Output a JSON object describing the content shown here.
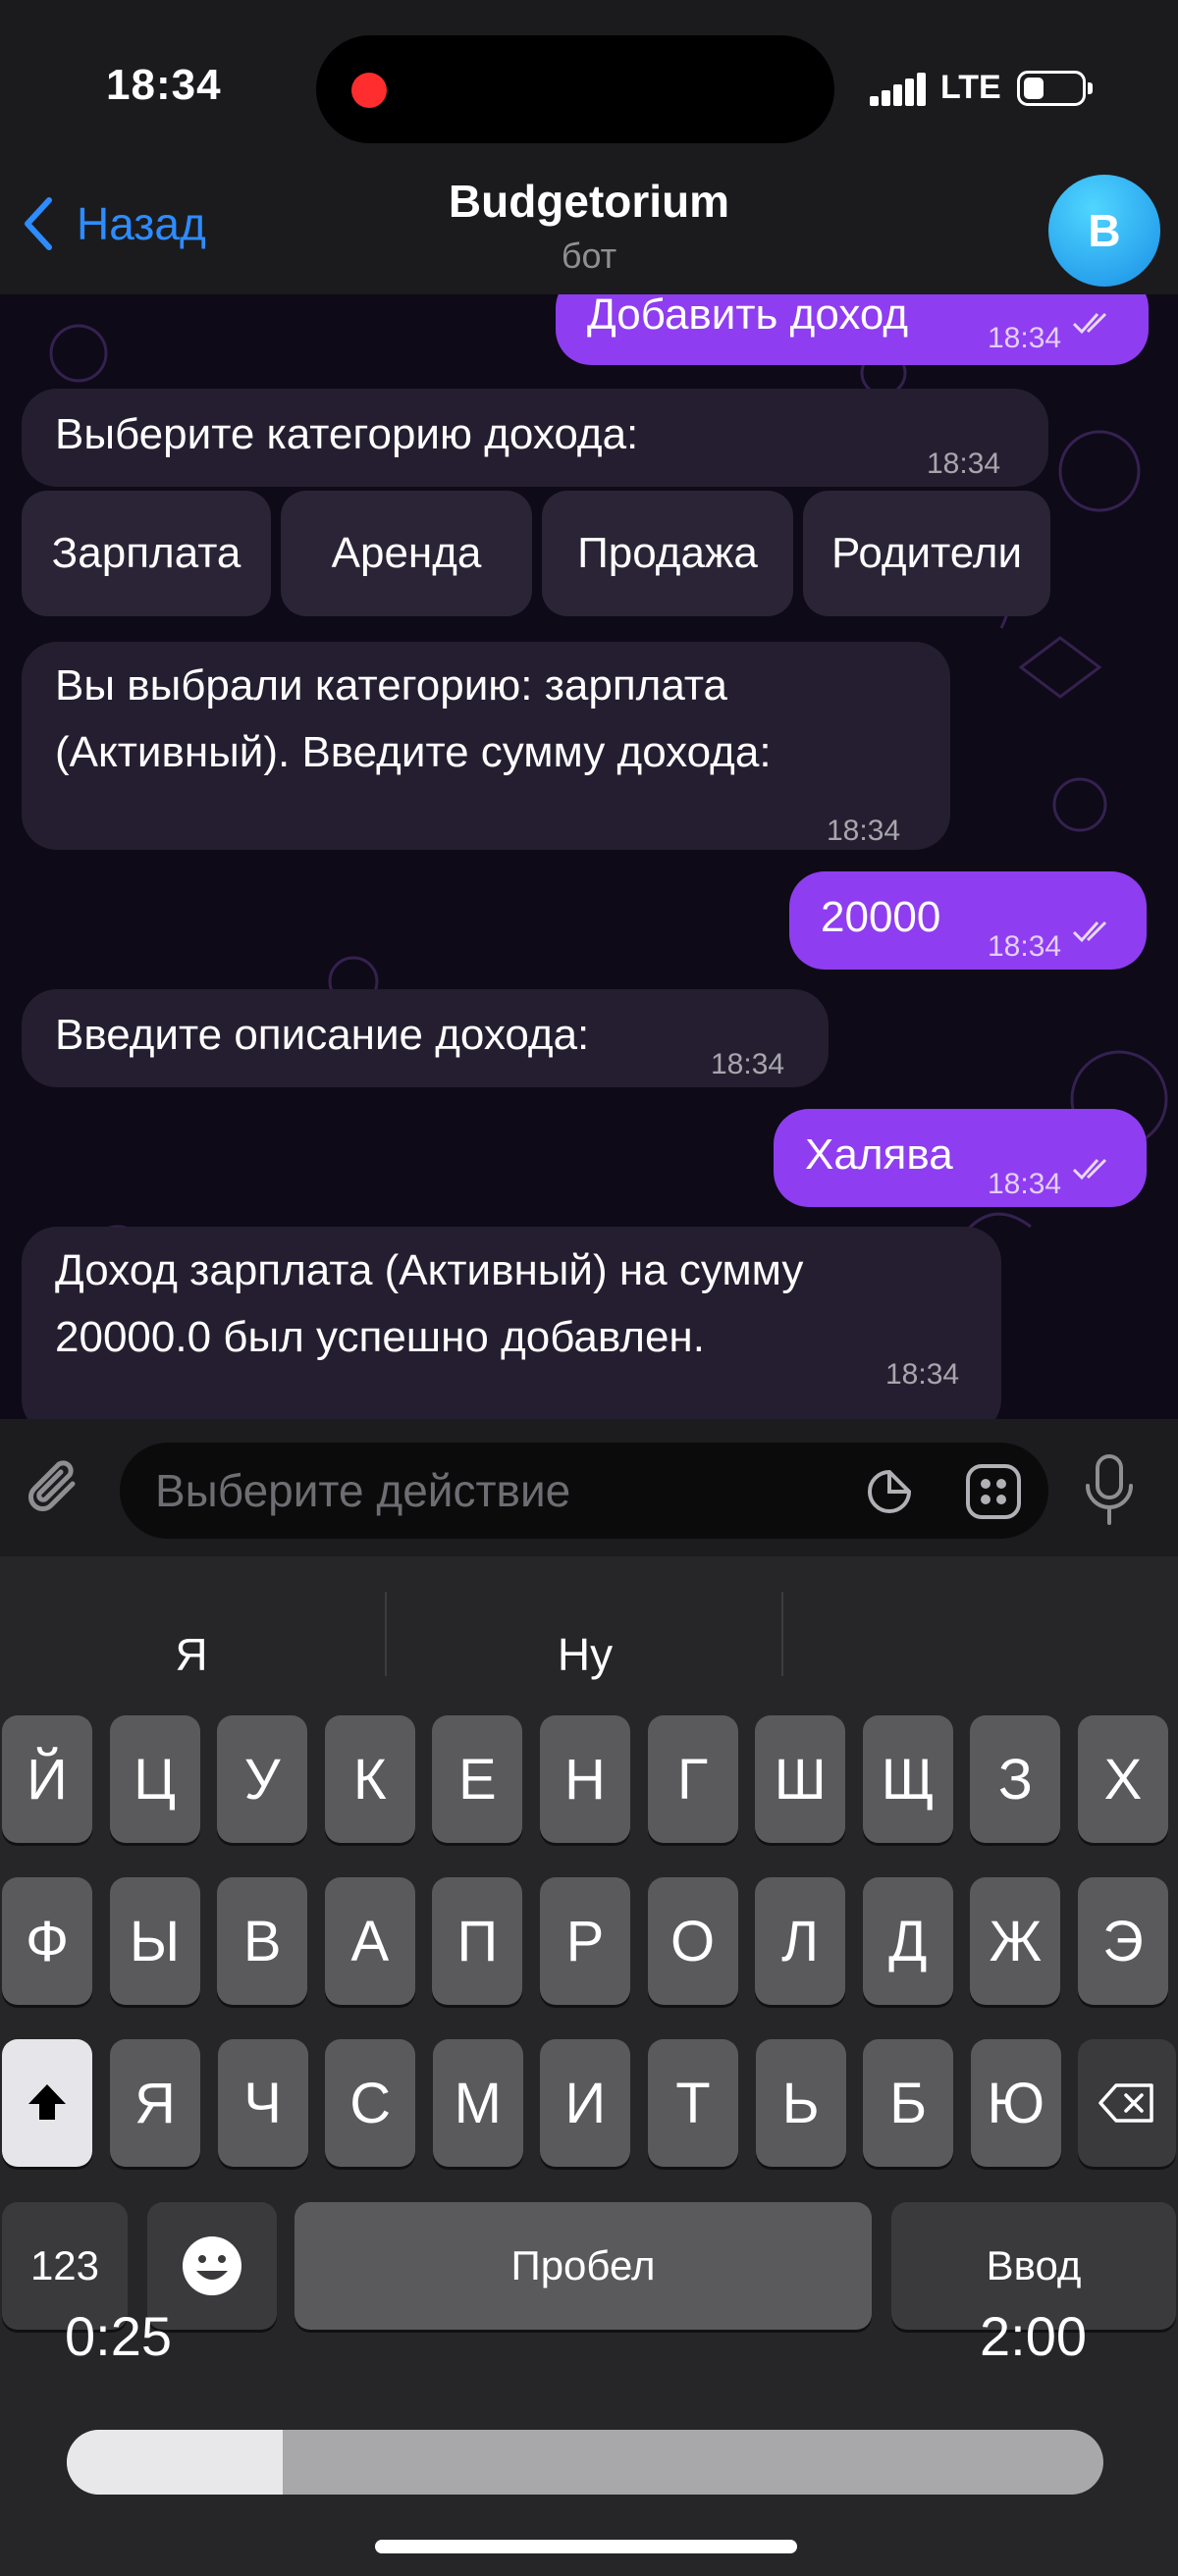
{
  "status": {
    "time": "18:34",
    "network": "LTE"
  },
  "header": {
    "back_label": "Назад",
    "title": "Budgetorium",
    "subtitle": "бот",
    "avatar_letter": "B"
  },
  "messages": [
    {
      "dir": "out",
      "text": "Добавить доход",
      "time": "18:34"
    },
    {
      "dir": "in",
      "text": "Выберите категорию дохода:",
      "time": "18:34"
    },
    {
      "dir": "in",
      "text_lines": [
        "Вы выбрали категорию: зарплата",
        "(Активный). Введите сумму дохода:"
      ],
      "time": "18:34"
    },
    {
      "dir": "out",
      "text": "20000",
      "time": "18:34"
    },
    {
      "dir": "in",
      "text": "Введите описание дохода:",
      "time": "18:34"
    },
    {
      "dir": "out",
      "text": "Халява",
      "time": "18:34"
    },
    {
      "dir": "in",
      "text_lines": [
        "Доход зарплата (Активный) на сумму",
        "20000.0 был успешно добавлен."
      ],
      "time": "18:34"
    }
  ],
  "inline_keyboard": [
    "Зарплата",
    "Аренда",
    "Продажа",
    "Родители"
  ],
  "composer": {
    "placeholder": "Выберите действие"
  },
  "keyboard": {
    "suggestions": [
      "Я",
      "Ну",
      ""
    ],
    "row1": [
      "Й",
      "Ц",
      "У",
      "К",
      "Е",
      "Н",
      "Г",
      "Ш",
      "Щ",
      "З",
      "Х"
    ],
    "row2": [
      "Ф",
      "Ы",
      "В",
      "А",
      "П",
      "Р",
      "О",
      "Л",
      "Д",
      "Ж",
      "Э"
    ],
    "row3": [
      "Я",
      "Ч",
      "С",
      "М",
      "И",
      "Т",
      "Ь",
      "Б",
      "Ю"
    ],
    "numbers_label": "123",
    "space_label": "Пробел",
    "return_label": "Ввод"
  },
  "video_overlay": {
    "elapsed": "0:25",
    "duration": "2:00",
    "progress": 0.208
  },
  "colors": {
    "accent": "#2d8cff",
    "outgoing": "#8f3df0",
    "incoming": "#251e30",
    "recording": "#ff2d2d"
  }
}
